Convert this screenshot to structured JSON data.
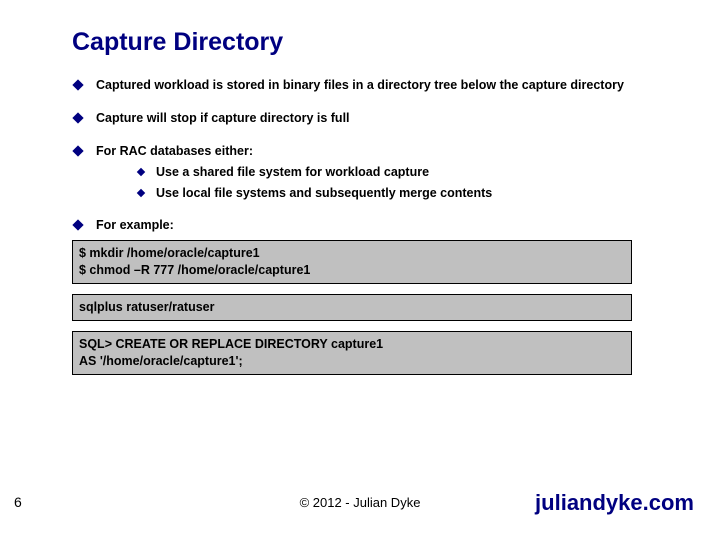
{
  "title": "Capture Directory",
  "bullets": {
    "b1": "Captured workload is stored in binary files in a directory tree below the capture directory",
    "b2": "Capture will stop if capture directory is full",
    "b3": "For RAC databases either:",
    "b3a": "Use a shared file system for workload capture",
    "b3b": "Use local file systems and subsequently merge contents",
    "b4": "For example:"
  },
  "code1": "$ mkdir /home/oracle/capture1\n$ chmod –R 777 /home/oracle/capture1",
  "code2": "sqlplus ratuser/ratuser",
  "code3": "SQL> CREATE OR REPLACE DIRECTORY capture1\nAS '/home/oracle/capture1';",
  "page": "6",
  "copyright": "© 2012 - Julian Dyke",
  "site": "juliandyke.com"
}
